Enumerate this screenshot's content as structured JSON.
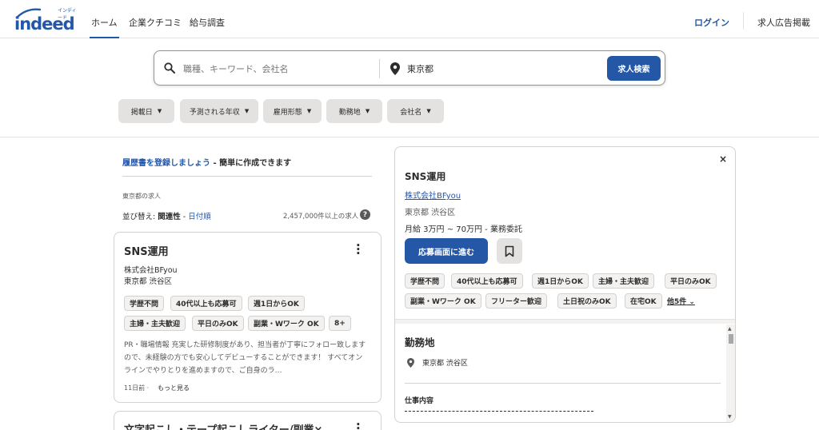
{
  "header": {
    "logo_text": "indeed",
    "logo_ruby": "インディード",
    "nav": [
      {
        "label": "ホーム",
        "active": true
      },
      {
        "label": "企業クチコミ",
        "active": false
      },
      {
        "label": "給与調査",
        "active": false
      }
    ],
    "login_label": "ログイン",
    "employer_label": "求人広告掲載",
    "brand_color": "#2557a7"
  },
  "search": {
    "what_placeholder": "職種、キーワード、会社名",
    "what_value": "",
    "where_value": "東京都",
    "button_label": "求人検索",
    "search_icon": "search-icon",
    "location_icon": "location-pin-icon"
  },
  "filters": [
    {
      "label": "掲載日"
    },
    {
      "label": "予測される年収"
    },
    {
      "label": "雇用形態"
    },
    {
      "label": "勤務地"
    },
    {
      "label": "会社名"
    }
  ],
  "left": {
    "resume_link": "履歴書を登録しましょう",
    "resume_rest": " - 簡単に作成できます",
    "location_jobs": "東京都の求人",
    "sort_prefix": "並び替え: ",
    "sort_active": "関連性",
    "sort_sep": " - ",
    "sort_other": "日付順",
    "count": "2,457,000件以上の求人",
    "help": "?"
  },
  "job_card": {
    "title": "SNS運用",
    "company": "株式会社BFyou",
    "location": "東京都 渋谷区",
    "tags": [
      "学歴不問",
      "40代以上も応募可",
      "週1日からOK",
      "主婦・主夫歓迎",
      "平日のみOK",
      "副業・Wワーク OK",
      "8+"
    ],
    "snippet": "PR・職場情報 充実した研修制度があり、担当者が丁寧にフォロー致しますので、未経験の方でも安心してデビューすることができます！ すべてオンラインでやりとりを進めますので、ご自身のラ…",
    "posted": "11日前",
    "posted_sep": "·",
    "more": "もっと見る"
  },
  "job_card_2": {
    "title": "文字起こし・テープ起こしライター/副業×"
  },
  "detail": {
    "title": "SNS運用",
    "company": "株式会社BFyou",
    "location": "東京都 渋谷区",
    "salary": "月給 3万円 ~ 70万円 - 業務委託",
    "apply_label": "応募画面に進む",
    "close": "×",
    "tags_row1": [
      "学歴不問",
      "40代以上も応募可",
      "週1日からOK",
      "主婦・主夫歓迎",
      "平日のみOK"
    ],
    "tags_row2": [
      "副業・Wワーク OK",
      "フリーター歓迎",
      "土日祝のみOK",
      "在宅OK"
    ],
    "more_tags": "他5件",
    "section_title": "勤務地",
    "section_location": "東京都 渋谷区",
    "job_description_label": "仕事内容"
  }
}
